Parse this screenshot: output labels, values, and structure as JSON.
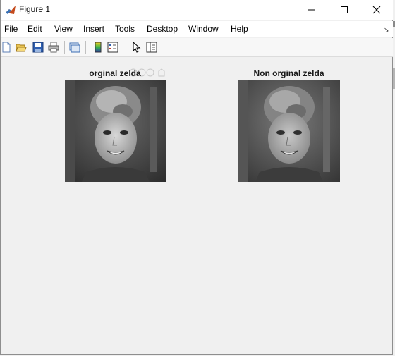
{
  "window": {
    "title": "Figure 1"
  },
  "menu": {
    "items": [
      "File",
      "Edit",
      "View",
      "Insert",
      "Tools",
      "Desktop",
      "Window",
      "Help"
    ]
  },
  "toolbar": {
    "icons": [
      "new-figure-icon",
      "open-file-icon",
      "save-icon",
      "print-icon",
      "link-plot-icon",
      "colorbar-icon",
      "legend-icon",
      "pointer-icon",
      "property-editor-icon"
    ]
  },
  "figure": {
    "axes": [
      {
        "title": "orginal zelda"
      },
      {
        "title": "Non orginal zelda"
      }
    ]
  },
  "colors": {
    "titlebar": "#ffffff",
    "client": "#f0f0f0",
    "accent": "#1a4fa0"
  }
}
